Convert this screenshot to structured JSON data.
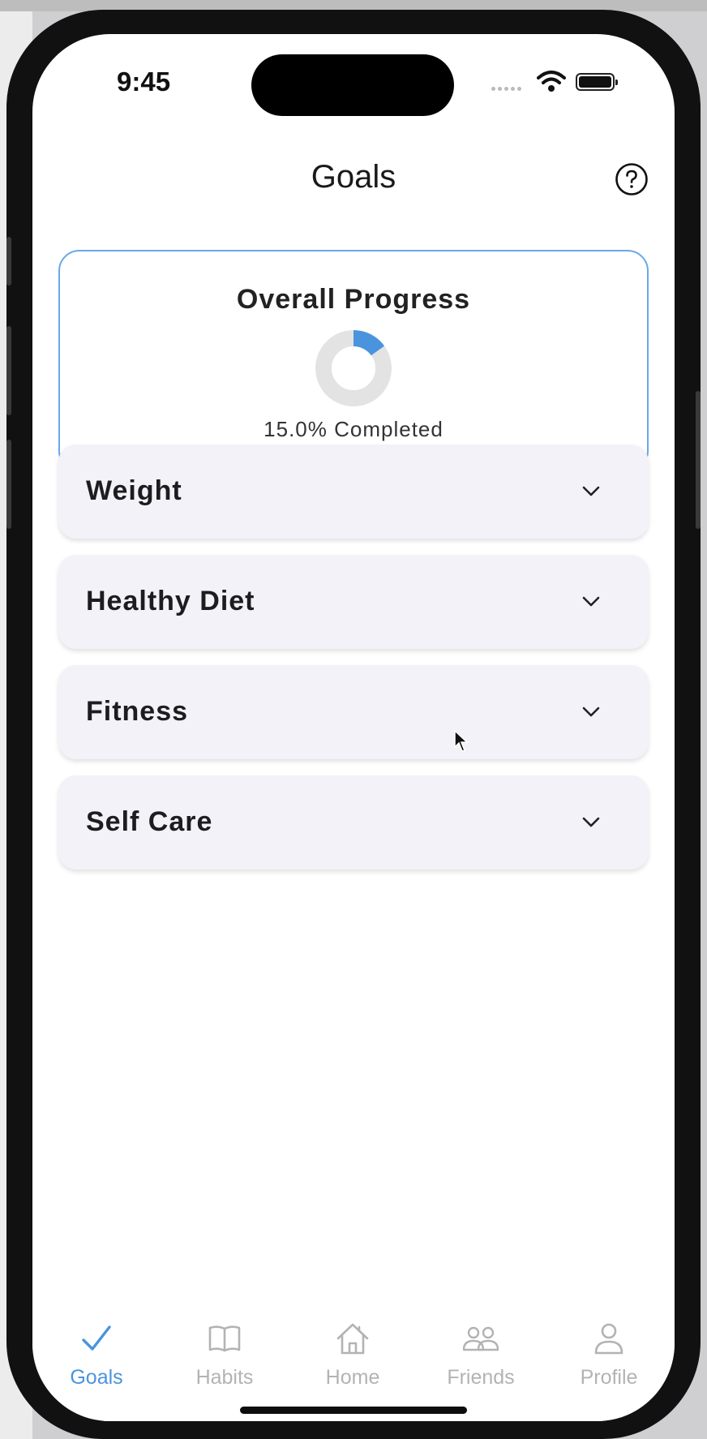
{
  "status_bar": {
    "time": "9:45"
  },
  "header": {
    "title": "Goals",
    "help_icon": "question-circle-icon"
  },
  "overall_progress": {
    "title": "Overall Progress",
    "percent": 15.0,
    "completed_text": "15.0% Completed",
    "accent_color": "#4a94de",
    "track_color": "#e3e3e3"
  },
  "goals": [
    {
      "label": "Weight",
      "icon": "chevron-down-icon"
    },
    {
      "label": "Healthy Diet",
      "icon": "chevron-down-icon"
    },
    {
      "label": "Fitness",
      "icon": "chevron-down-icon"
    },
    {
      "label": "Self Care",
      "icon": "chevron-down-icon"
    }
  ],
  "tab_bar": {
    "active": "Goals",
    "tabs": [
      {
        "label": "Goals",
        "icon": "checkmark-icon"
      },
      {
        "label": "Habits",
        "icon": "book-icon"
      },
      {
        "label": "Home",
        "icon": "house-icon"
      },
      {
        "label": "Friends",
        "icon": "people-icon"
      },
      {
        "label": "Profile",
        "icon": "person-icon"
      }
    ]
  }
}
